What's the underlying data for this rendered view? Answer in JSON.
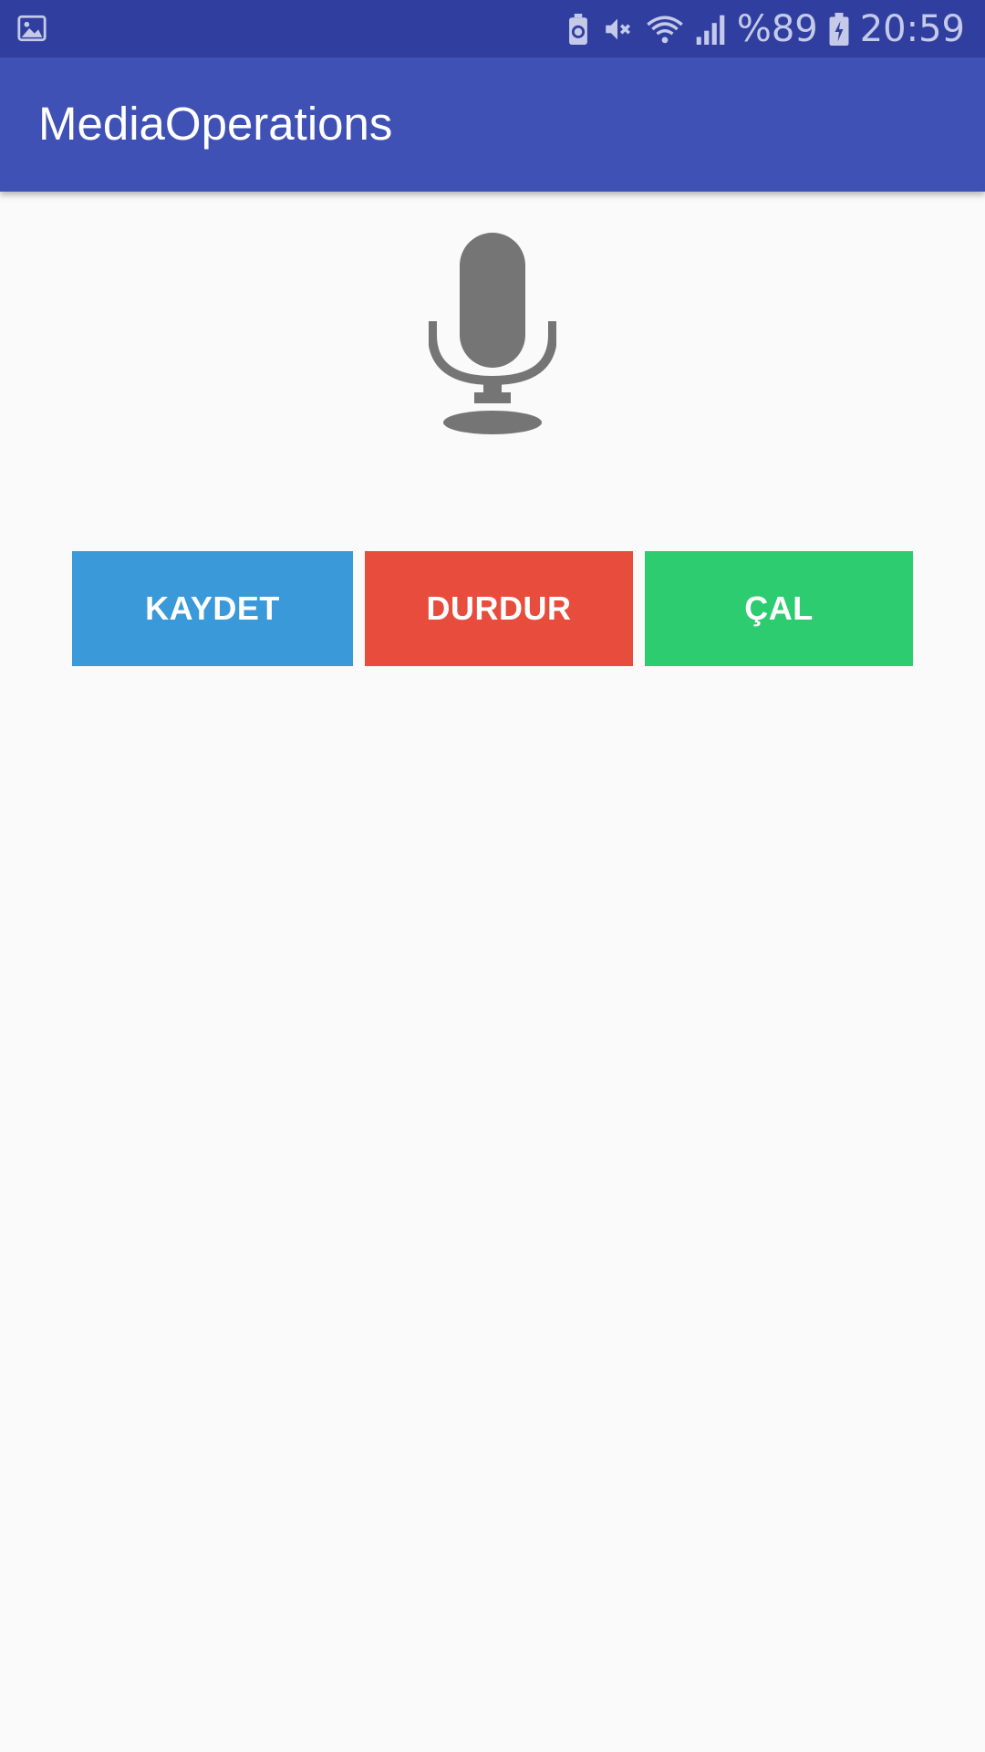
{
  "status_bar": {
    "battery_percent": "%89",
    "time": "20:59",
    "icons": [
      "image-notification-icon",
      "battery-saver-icon",
      "mute-icon",
      "wifi-icon",
      "signal-icon",
      "battery-charging-icon"
    ]
  },
  "app_bar": {
    "title": "MediaOperations",
    "color": "#3f51b5"
  },
  "main": {
    "icon": "microphone-icon",
    "buttons": [
      {
        "label": "KAYDET",
        "color": "#3a9ad9"
      },
      {
        "label": "DURDUR",
        "color": "#e74c3c"
      },
      {
        "label": "ÇAL",
        "color": "#2ecc71"
      }
    ]
  }
}
